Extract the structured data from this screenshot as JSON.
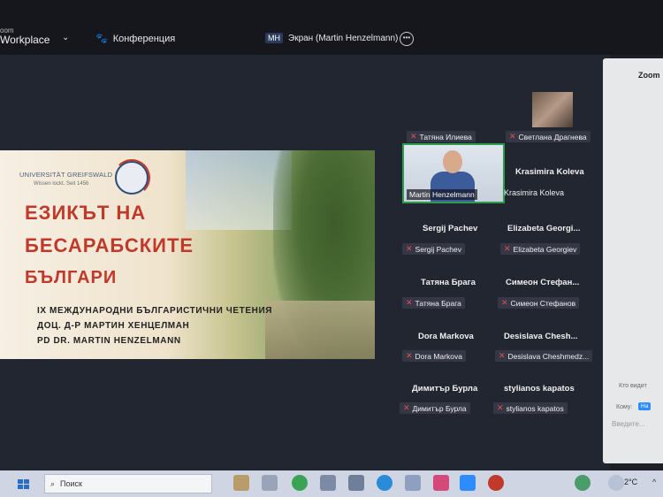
{
  "header": {
    "app_name": "Workplace",
    "app_sub": "oom",
    "conference_label": "Конференция",
    "screen_badge": "MH",
    "screen_share_label": "Экран (Martin Henzelmann)",
    "more_label": "•••"
  },
  "slide": {
    "university": "UNIVERSITÄT GREIFSWALD",
    "university_sub": "Wissen lockt. Seit 1456",
    "title_line1": "Езикът на",
    "title_line2": "бесарабските",
    "title_line3": "българи",
    "sub_line1": "IX МЕЖДУНАРОДНИ БЪЛГАРИСТИЧНИ ЧЕТЕНИЯ",
    "sub_line2": "ДОЦ. Д-Р МАРТИН ХЕНЦЕЛМАН",
    "sub_line3": "PD DR. MARTIN HENZELMANN"
  },
  "participants": [
    {
      "name": "Татяна Илиева"
    },
    {
      "name": "Светлана Драгнева"
    },
    {
      "name": "Martin Henzelmann"
    },
    {
      "name": "Krasimira Koleva",
      "label": "Krasimira Koleva"
    },
    {
      "name": "Sergij Pachev",
      "label": "Sergij Pachev"
    },
    {
      "name": "Elizabeta Georgi...",
      "label": "Elizabeta Georgiev"
    },
    {
      "name": "Татяна Брага",
      "label": "Татяна Брага"
    },
    {
      "name": "Симеон Стефан...",
      "label": "Симеон Стефанов"
    },
    {
      "name": "Dora Markova",
      "label": "Dora Markova"
    },
    {
      "name": "Desislava Chesh...",
      "label": "Desislava Cheshmedz..."
    },
    {
      "name": "Димитър Бурла",
      "label": "Димитър Бурла"
    },
    {
      "name": "stylianos kapatos",
      "label": "stylianos kapatos"
    }
  ],
  "chat": {
    "title": "Zoom",
    "who_label": "Кто видит",
    "to_label": "Кому:",
    "to_value": "Ha",
    "placeholder": "Введите..."
  },
  "taskbar": {
    "search_placeholder": "Поиск",
    "temperature": "2°C",
    "tray_caret": "^"
  },
  "colors": {
    "accent_red": "#c0392b",
    "active_speaker_border": "#2e9a4b",
    "chat_button": "#2d8cff"
  }
}
